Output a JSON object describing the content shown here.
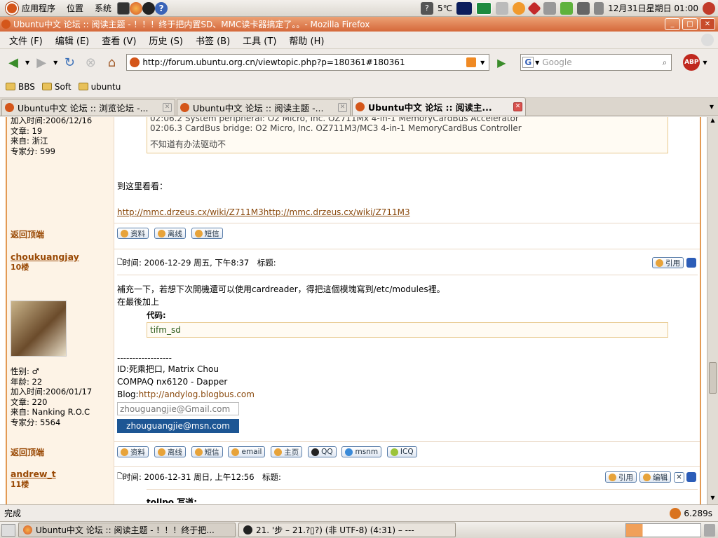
{
  "panel": {
    "menus": [
      "应用程序",
      "位置",
      "系统"
    ],
    "temperature": "5℃",
    "clock": "12月31日星期日 01:00"
  },
  "window": {
    "title": "Ubuntu中文 论坛 :: 阅读主题 - ！！！终于把内置SD、MMC读卡器搞定了。。- Mozilla Firefox"
  },
  "menubar": [
    "文件 (F)",
    "编辑 (E)",
    "查看 (V)",
    "历史 (S)",
    "书签 (B)",
    "工具 (T)",
    "帮助 (H)"
  ],
  "nav": {
    "url": "http://forum.ubuntu.org.cn/viewtopic.php?p=180361#180361",
    "search_placeholder": "Google",
    "abp": "ABP"
  },
  "bookmarks": [
    "BBS",
    "Soft",
    "ubuntu"
  ],
  "tabs": [
    {
      "label": "Ubuntu中文 论坛 :: 浏览论坛 -...",
      "active": false
    },
    {
      "label": "Ubuntu中文 论坛 :: 阅读主题 -...",
      "active": false
    },
    {
      "label": "Ubuntu中文 论坛 :: 阅读主...",
      "active": true
    }
  ],
  "post1": {
    "profile": [
      "加入时间:2006/12/16",
      "文章: 19",
      "来自: 浙江",
      "专家分: 599"
    ],
    "code_lines": [
      "02:06.2 System peripheral: O2 Micro, Inc. OZ711Mx 4-in-1 MemoryCardBus Accelerator",
      "02:06.3 CardBus bridge: O2 Micro, Inc. OZ711M3/MC3 4-in-1 MemoryCardBus Controller",
      "不知道有办法驱动不"
    ],
    "body_text": "到这里看看：",
    "link": "http://mmc.drzeus.cx/wiki/Z711M3http://mmc.drzeus.cx/wiki/Z711M3",
    "back": "返回顶端",
    "buttons": [
      "资料",
      "离线",
      "短信"
    ]
  },
  "post2": {
    "username": "choukuangjay",
    "floor": "10楼",
    "meta": "时间: 2006-12-29 周五, 下午8:37　标题:",
    "quote_btn": "引用",
    "lines": [
      "補充一下，若想下次開機還可以使用cardreader，得把這個模塊寫到/etc/modules裡。",
      "在最後加上"
    ],
    "code_label": "代码:",
    "code": "tifm_sd",
    "sig_sep": "------------------",
    "sig": [
      "ID:死乘把口, Matrix Chou",
      "COMPAQ nx6120 - Dapper"
    ],
    "blog_label": "Blog:",
    "blog_url": "http://andylog.blogbus.com",
    "gmail": "zhouguangjie@Gmail.com",
    "msn": "zhouguangjie@msn.com",
    "profile": [
      "性别: ♂",
      "年龄: 22",
      "加入时间:2006/01/17",
      "文章: 220",
      "来自: Nanking R.O.C",
      "专家分: 5564"
    ],
    "back": "返回顶端",
    "buttons": [
      "资料",
      "离线",
      "短信",
      "email",
      "主页",
      "QQ",
      "msnm",
      "ICQ"
    ]
  },
  "post3": {
    "username": "andrew_t",
    "floor": "11楼",
    "meta": "时间: 2006-12-31 周日, 上午12:56　标题:",
    "buttons": [
      "引用",
      "编辑"
    ],
    "partial": "tollpo 写道:"
  },
  "status": {
    "text": "完成",
    "time": "6.289s"
  },
  "taskbar": [
    "Ubuntu中文 论坛 :: 阅读主题 - ！！！终于把...",
    "21. '步 – 21.?▯?) (非 UTF-8) (4:31) – ---"
  ]
}
